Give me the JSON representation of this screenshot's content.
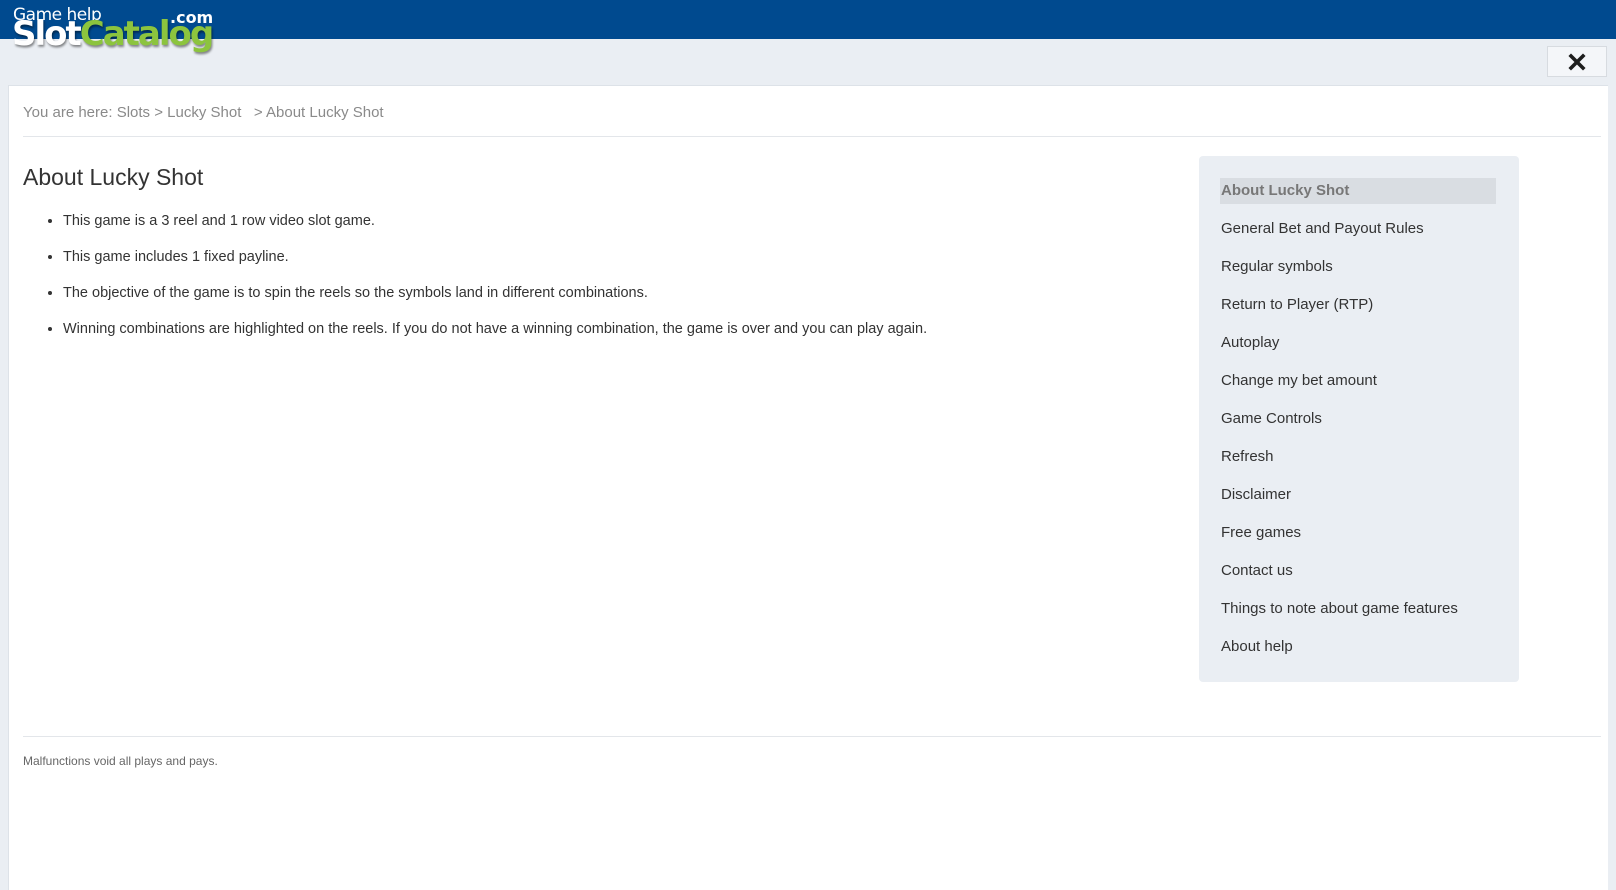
{
  "logo": {
    "small_text": "Game help",
    "domain_suffix": ".com",
    "brand_part1": "Slot",
    "brand_part2": "Catalog"
  },
  "close_button": {
    "icon": "close-icon"
  },
  "breadcrumb": {
    "prefix": "You are here:",
    "items": [
      "Slots",
      "Lucky Shot",
      "About Lucky Shot"
    ],
    "separator": ">"
  },
  "main": {
    "title": "About Lucky Shot",
    "bullets": [
      "This game is a 3 reel and 1 row video slot game.",
      "This game includes 1 fixed payline.",
      "The objective of the game is to spin the reels so the symbols land in different combinations.",
      "Winning combinations are highlighted on the reels. If you do not have a winning combination, the game is over and you can play again."
    ]
  },
  "sidebar": {
    "active_index": 0,
    "items": [
      "About Lucky Shot",
      "General Bet and Payout Rules",
      "Regular symbols",
      "Return to Player (RTP)",
      "Autoplay",
      "Change my bet amount",
      "Game Controls",
      "Refresh",
      "Disclaimer",
      "Free games",
      "Contact us",
      "Things to note about game features",
      "About help"
    ]
  },
  "footer": {
    "note": "Malfunctions void all plays and pays."
  },
  "colors": {
    "header_blue": "#004a8f",
    "brand_green": "#8cc43e",
    "page_bg": "#eaeef3",
    "text": "#333333",
    "muted_text": "#8a8a8a"
  }
}
